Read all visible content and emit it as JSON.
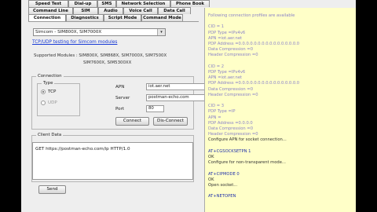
{
  "tabs_row1": [
    "Speed Test",
    "Dial-up",
    "SMS",
    "Network Selection",
    "Phone Book"
  ],
  "tabs_row2": [
    "Command Line",
    "SIM",
    "Audio",
    "Voice Call",
    "Data Call"
  ],
  "tabs_row3": [
    "Connection",
    "Diagnostics",
    "Script Mode",
    "Command Mode"
  ],
  "module_select": {
    "value": "Simcom - SIM800X, SIM7000X",
    "arrow": "▾"
  },
  "tcp_link": "TCP/UDP testing for Simcom modules",
  "supported": {
    "line1": "Supported Modules : SIM800X, SIM868X, SIM7000X, SIM7500X",
    "line2": "SIM7600X, SIM5300XX"
  },
  "connection": {
    "legend": "Connection",
    "type_legend": "Type",
    "tcp": "TCP",
    "udp": "UDP",
    "apn_label": "APN",
    "apn_value": "iot.aer.net",
    "server_label": "Server",
    "server_value": "postman-echo.com",
    "port_label": "Port",
    "port_value": "80",
    "connect": "Connect",
    "disconnect": "Dis-Connect"
  },
  "client": {
    "legend": "Client Data",
    "request": "GET https://postman-echo.com/ip HTTP/1.0",
    "send": "Send"
  },
  "log": [
    {
      "t": "Following connection profiles are available",
      "s": "a"
    },
    {
      "t": "",
      "s": "a"
    },
    {
      "t": "CID = 1",
      "s": "a"
    },
    {
      "t": "PDP Type =IPv4v6",
      "s": "a"
    },
    {
      "t": "APN =iot.aer.net",
      "s": "a"
    },
    {
      "t": "PDP Address =0.0.0.0.0.0.0.0.0.0.0.0.0.0.0.0",
      "s": "a"
    },
    {
      "t": "Data Compression =0",
      "s": "a"
    },
    {
      "t": "Header Compression =0",
      "s": "a"
    },
    {
      "t": "",
      "s": "a"
    },
    {
      "t": "CID = 2",
      "s": "a"
    },
    {
      "t": "PDP Type =IPv4v6",
      "s": "a"
    },
    {
      "t": "APN =iot.aer.net",
      "s": "a"
    },
    {
      "t": "PDP Address =0.0.0.0.0.0.0.0.0.0.0.0.0.0.0.0",
      "s": "a"
    },
    {
      "t": "Data Compression =0",
      "s": "a"
    },
    {
      "t": "Header Compression =0",
      "s": "a"
    },
    {
      "t": "",
      "s": "a"
    },
    {
      "t": "CID = 3",
      "s": "a"
    },
    {
      "t": "PDP Type =IP",
      "s": "a"
    },
    {
      "t": "APN =",
      "s": "a"
    },
    {
      "t": "PDP Address =0.0.0.0",
      "s": "a"
    },
    {
      "t": "Data Compression =0",
      "s": "a"
    },
    {
      "t": "Header Compression =0",
      "s": "a"
    },
    {
      "t": "Configure APN for socket connection...",
      "s": "b"
    },
    {
      "t": "",
      "s": "a"
    },
    {
      "t": "AT+CGSOCKSETPN  1",
      "s": "c"
    },
    {
      "t": "OK",
      "s": "b"
    },
    {
      "t": "Configure for non-transparent mode...",
      "s": "b"
    },
    {
      "t": "",
      "s": "a"
    },
    {
      "t": "AT+CIPMODE  0",
      "s": "c"
    },
    {
      "t": "OK",
      "s": "b"
    },
    {
      "t": "Open socket...",
      "s": "b"
    },
    {
      "t": "",
      "s": "a"
    },
    {
      "t": "AT+NETOPEN",
      "s": "c"
    }
  ]
}
